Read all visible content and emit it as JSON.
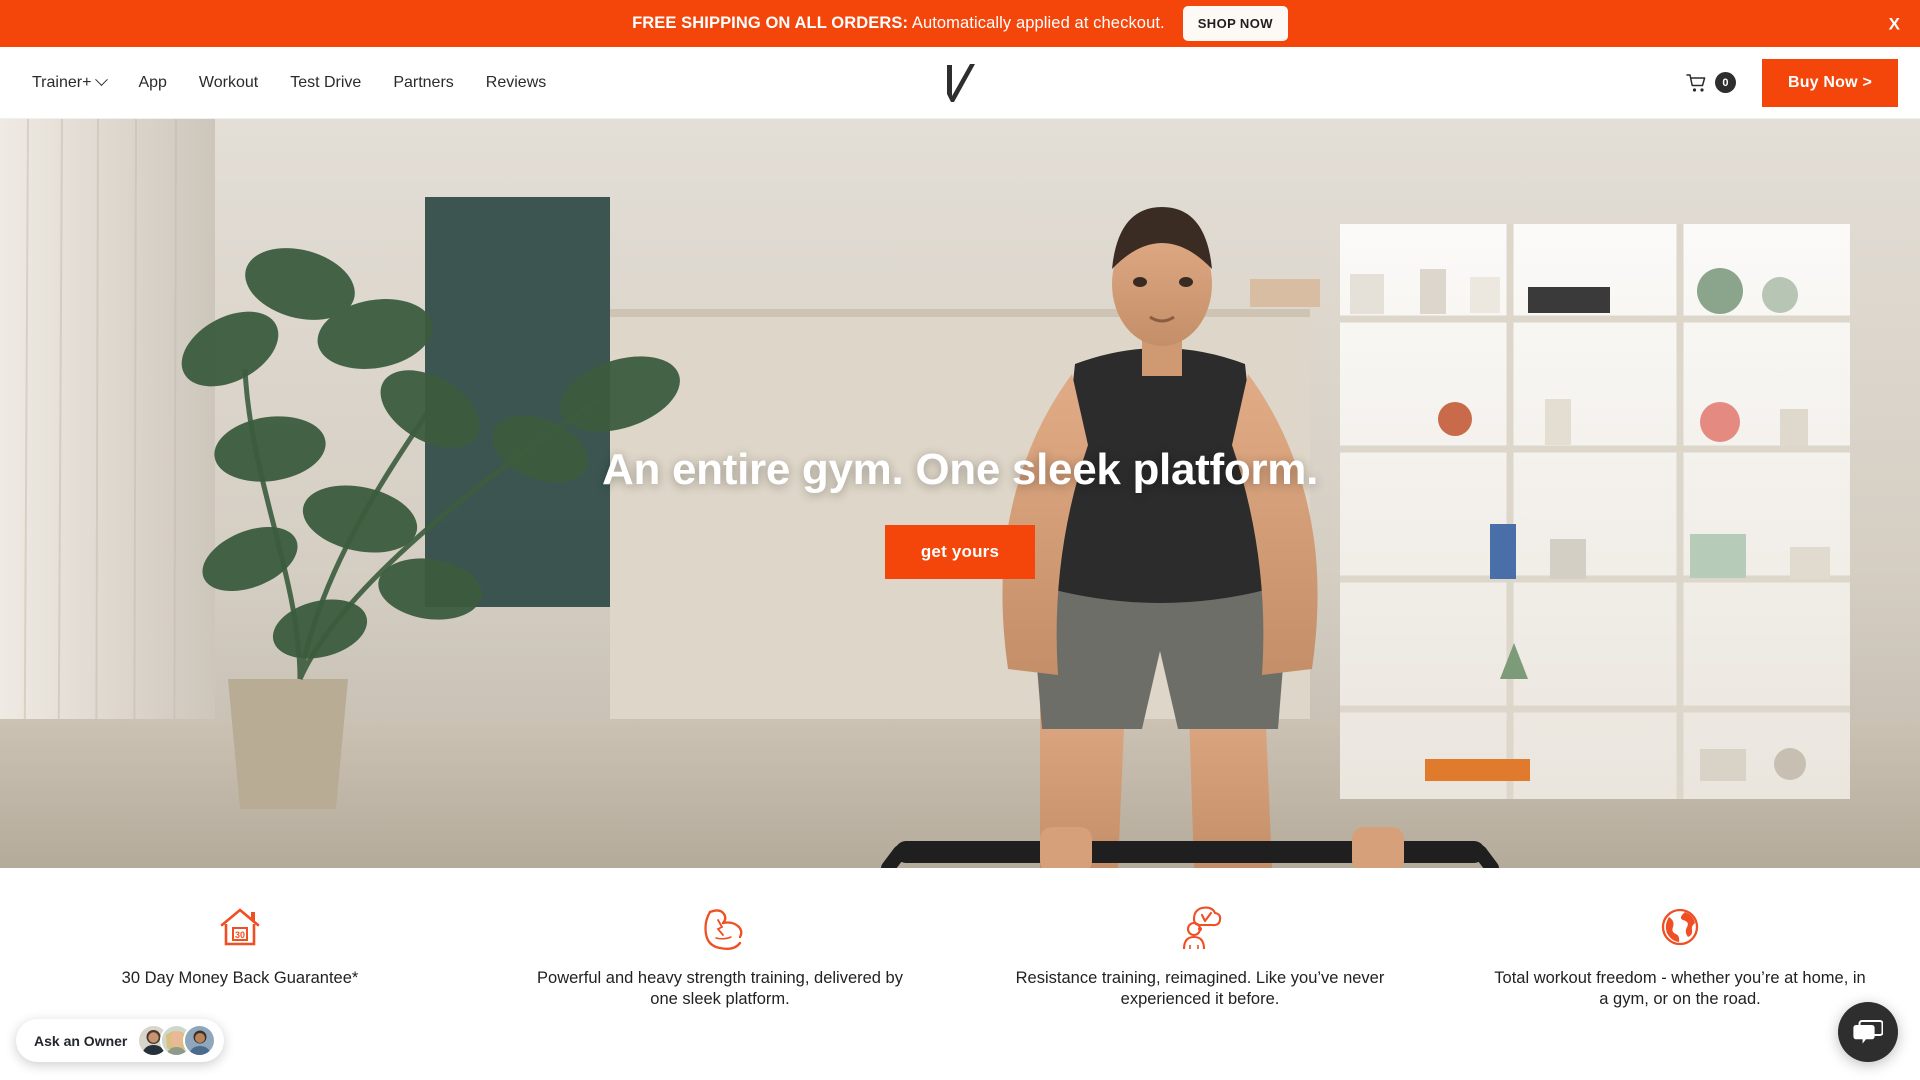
{
  "promo": {
    "strong": "FREE SHIPPING ON ALL ORDERS:",
    "rest": " Automatically applied at checkout.",
    "shop_now": "SHOP NOW",
    "close": "X",
    "bg_color": "#F4450A"
  },
  "nav": {
    "items": [
      {
        "label": "Trainer+",
        "has_caret": true
      },
      {
        "label": "App",
        "has_caret": false
      },
      {
        "label": "Workout",
        "has_caret": false
      },
      {
        "label": "Test Drive",
        "has_caret": false
      },
      {
        "label": "Partners",
        "has_caret": false
      },
      {
        "label": "Reviews",
        "has_caret": false
      }
    ],
    "logo_name": "vitruvian-v-logo",
    "cart_count": "0",
    "buy_now": "Buy Now >"
  },
  "hero": {
    "title": "An entire gym. One sleek platform.",
    "cta": "get yours"
  },
  "features": [
    {
      "icon": "house-30-day-icon",
      "text": "30 Day Money Back Guarantee*"
    },
    {
      "icon": "flexed-bicep-icon",
      "text": "Powerful and heavy strength training, delivered by one sleek platform."
    },
    {
      "icon": "person-thought-bubble-icon",
      "text": "Resistance training, reimagined. Like you’ve never experienced it before."
    },
    {
      "icon": "globe-icon",
      "text": "Total workout freedom - whether you’re at home, in a gym, or on the road."
    }
  ],
  "widgets": {
    "ask_owner_label": "Ask an Owner",
    "chat_icon": "chat-bubbles-icon"
  },
  "colors": {
    "accent_orange": "#F4450A",
    "dark": "#2e2e2e",
    "text": "#222222"
  }
}
